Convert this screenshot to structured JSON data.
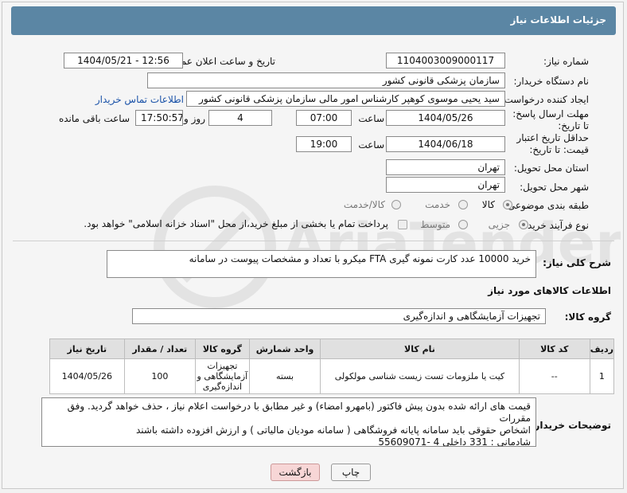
{
  "header": {
    "title": "جزئیات اطلاعات نیاز"
  },
  "fields": {
    "need_number_label": "شماره نیاز:",
    "need_number": "1104003009000117",
    "announce_label": "تاریخ و ساعت اعلان عمومی:",
    "announce_value": "1404/05/21 - 12:56",
    "buyer_org_label": "نام دستگاه خریدار:",
    "buyer_org": "سازمان پزشکی قانونی کشور",
    "requester_label": "ایجاد کننده درخواست:",
    "requester": "سید یحیی موسوی کوهپر کارشناس امور مالی سازمان پزشکی قانونی کشور",
    "contact_link": "اطلاعات تماس خریدار",
    "reply_deadline_label": "مهلت ارسال پاسخ: تا تاریخ:",
    "reply_date": "1404/05/26",
    "time_label": "ساعت",
    "reply_time": "07:00",
    "days_value": "4",
    "days_label": "روز و",
    "remaining_time": "17:50:57",
    "remaining_label": "ساعت باقی مانده",
    "validity_label": "حداقل تاریخ اعتبار قیمت: تا تاریخ:",
    "validity_date": "1404/06/18",
    "validity_time": "19:00",
    "province_label": "استان محل تحویل:",
    "province": "تهران",
    "city_label": "شهر محل تحویل:",
    "city": "تهران",
    "category_label": "طبقه بندی موضوعی:",
    "category_goods": "کالا",
    "category_service": "خدمت",
    "category_both": "کالا/خدمت",
    "process_label": "نوع فرآیند خرید :",
    "process_partial": "جزیی",
    "process_medium": "متوسط",
    "payment_note": "پرداخت تمام یا بخشی از مبلغ خرید،از محل \"اسناد خزانه اسلامی\" خواهد بود."
  },
  "description": {
    "label": "شرح کلی نیاز:",
    "text": "خرید 10000 عدد کارت  نمونه گیری FTA  میکرو با تعداد و مشخصات پیوست در سامانه"
  },
  "goods_section": {
    "title": "اطلاعات کالاهای مورد نیاز",
    "group_label": "گروه کالا:",
    "group_value": "تجهیزات آزمایشگاهی و اندازه‌گیری"
  },
  "table": {
    "headers": [
      "ردیف",
      "کد کالا",
      "نام کالا",
      "واحد شمارش",
      "گروه کالا",
      "تعداد / مقدار",
      "تاریخ نیاز"
    ],
    "rows": [
      [
        "1",
        "--",
        "کیت یا ملزومات تست زیست شناسی مولکولی",
        "بسته",
        "تجهیزات آزمایشگاهی و اندازه‌گیری",
        "100",
        "1404/05/26"
      ]
    ]
  },
  "buyer_notes": {
    "label": "توضیحات خریدار:",
    "line1": "قیمت های ارائه شده بدون پیش فاکتور (بامهرو امضاء) و غیر مطابق با درخواست اعلام نیاز  ، حذف خواهد گردید. وفق مقررات",
    "line2": "اشخاص حقوقی باید سامانه پایانه فروشگاهی ( سامانه مودیان مالیاتی ) و ارزش افزوده  داشته باشند",
    "line3": "شادمانی :    331 داخلی  4 -55609071"
  },
  "buttons": {
    "print": "چاپ",
    "back": "بازگشت"
  },
  "watermark": "AriaTender.net",
  "colors": {
    "header_bg": "#5b86a4",
    "link": "#1a52a8",
    "back_btn": "#f7d6d6"
  }
}
